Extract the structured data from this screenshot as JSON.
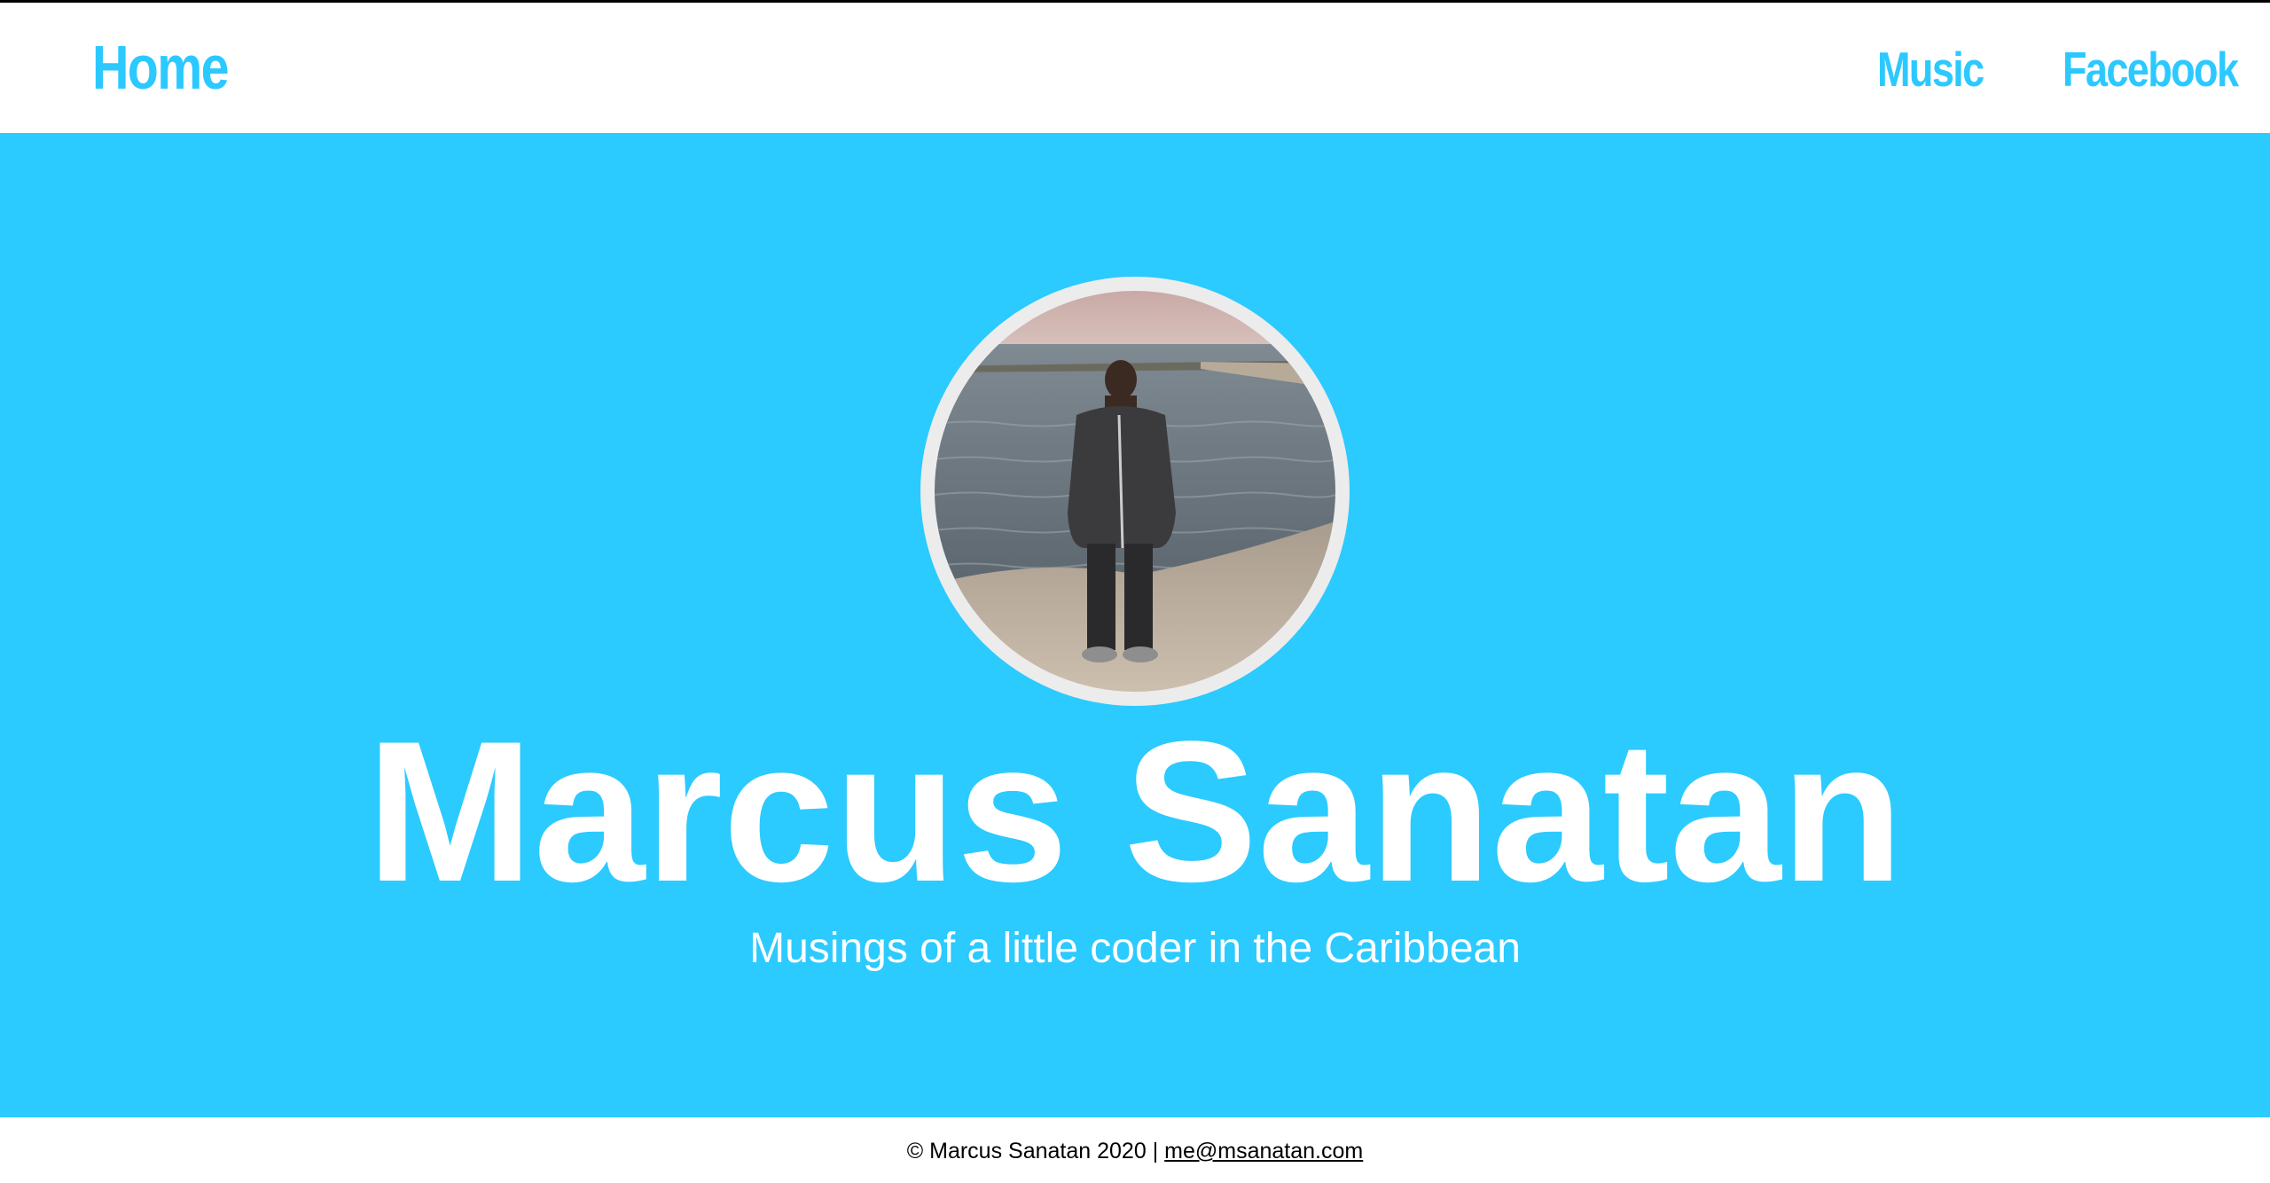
{
  "nav": {
    "home_label": "Home",
    "music_label": "Music",
    "facebook_label": "Facebook"
  },
  "hero": {
    "title": "Marcus Sanatan",
    "subtitle": "Musings of a little coder in the Caribbean"
  },
  "footer": {
    "copyright": "© Marcus Sanatan 2020",
    "separator": "|",
    "email": "me@msanatan.com"
  },
  "colors": {
    "accent": "#2bcaff",
    "text_on_accent": "#ffffff",
    "avatar_ring": "#ececec"
  }
}
